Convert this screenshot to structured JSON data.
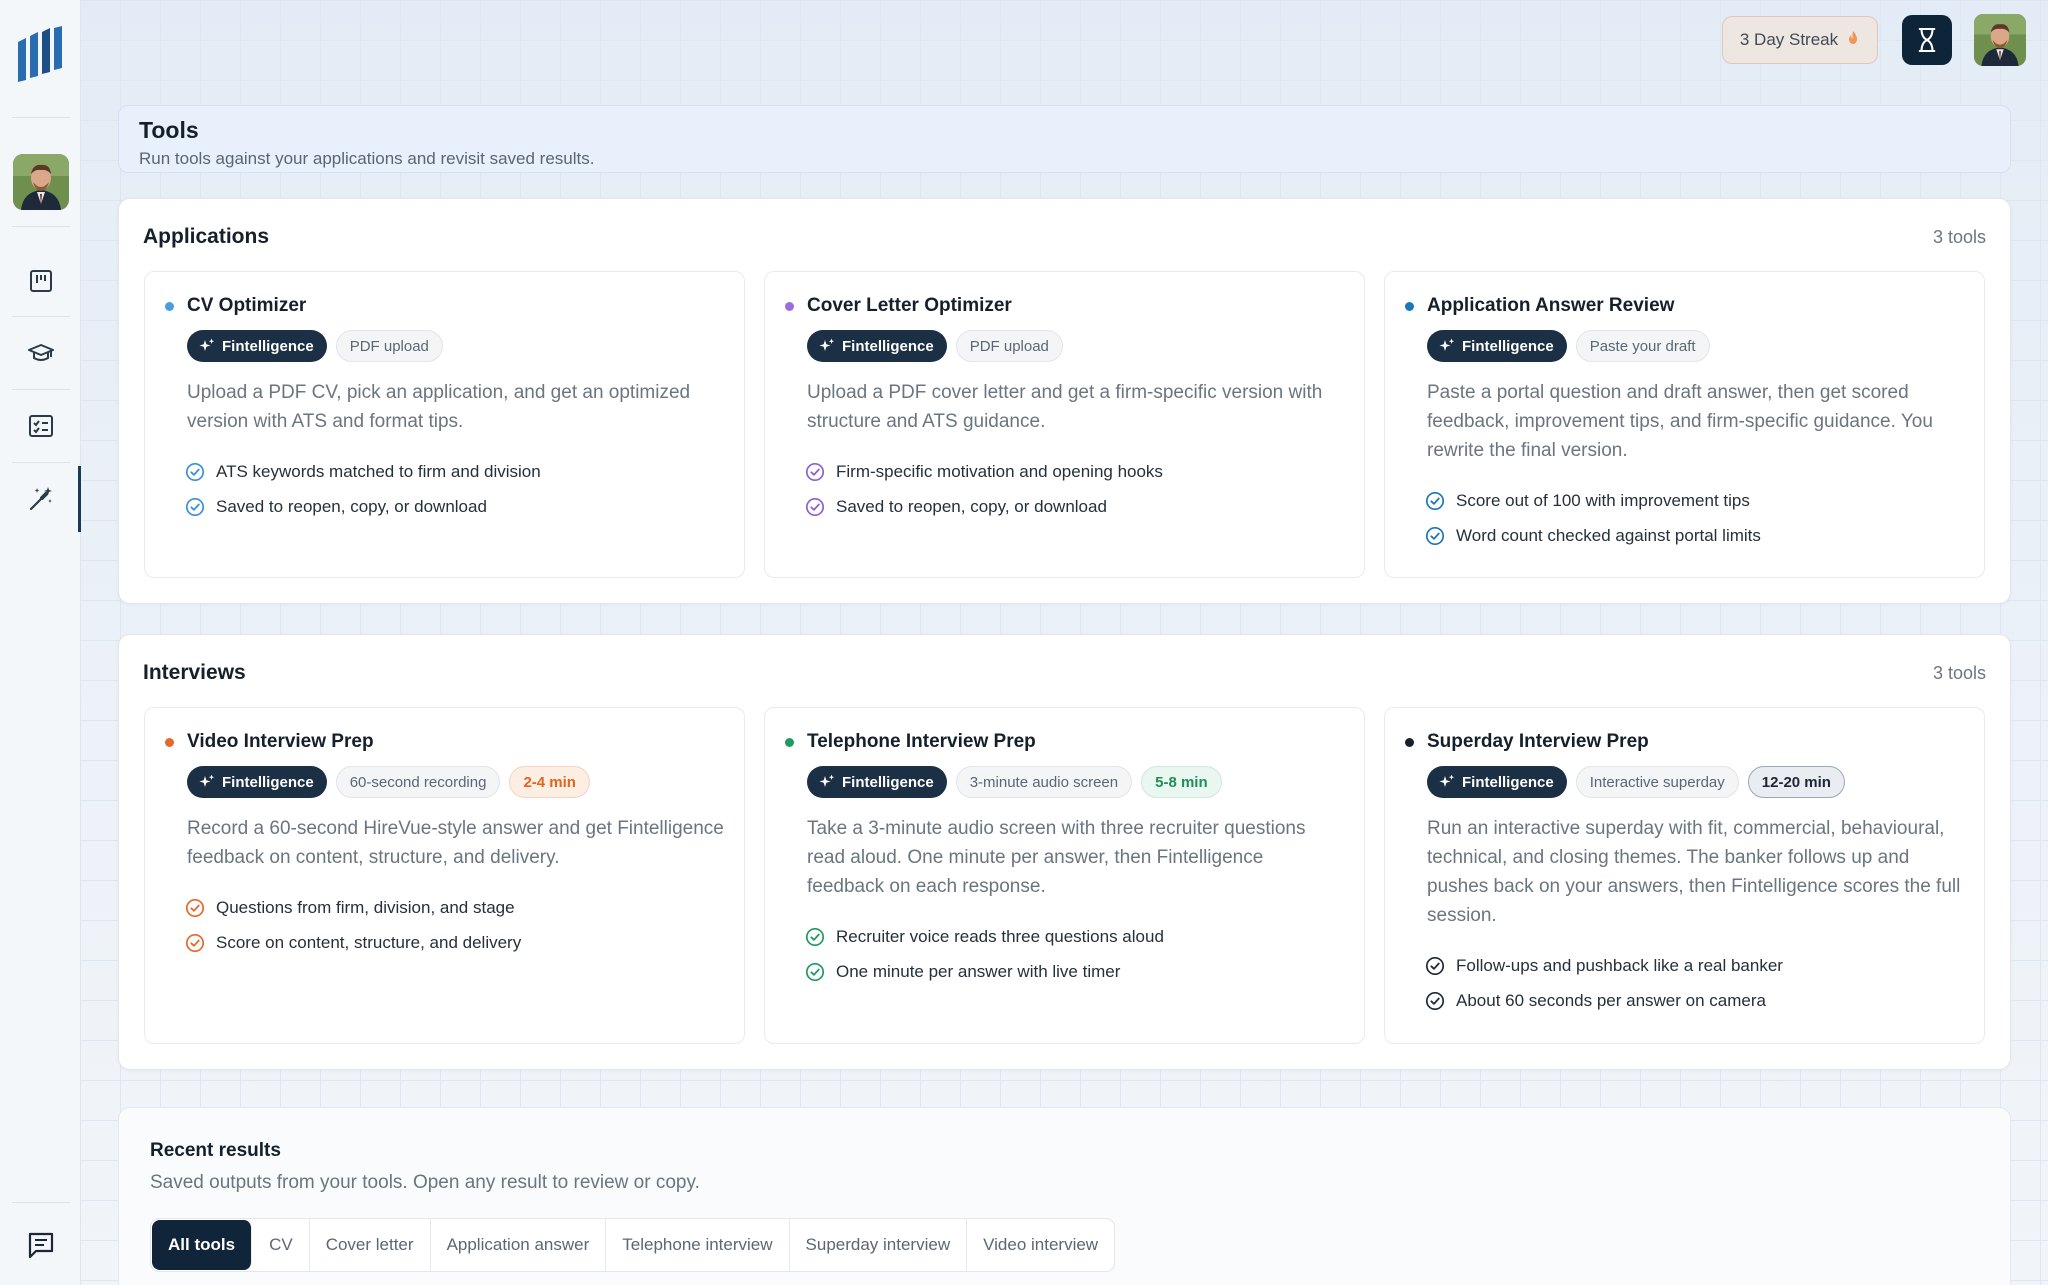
{
  "topbar": {
    "streak_label": "3 Day Streak",
    "streak_icon": "flame-icon"
  },
  "sidebar": {
    "items": [
      {
        "name": "board-icon"
      },
      {
        "name": "graduation-cap-icon"
      },
      {
        "name": "checklist-icon"
      },
      {
        "name": "magic-wand-icon",
        "active": true
      }
    ],
    "footer_icon": "chat-icon"
  },
  "header": {
    "title": "Tools",
    "subtitle": "Run tools against your applications and revisit saved results."
  },
  "applications": {
    "title": "Applications",
    "count": "3 tools",
    "cards": [
      {
        "title": "CV Optimizer",
        "dot_color": "#4a9be0",
        "ai_badge": "Fintelligence",
        "badges": [
          "PDF upload"
        ],
        "desc": "Upload a PDF CV, pick an application, and get an optimized version with ATS and format tips.",
        "check_color": "#3a8fd8",
        "features": [
          "ATS keywords matched to firm and division",
          "Saved to reopen, copy, or download"
        ]
      },
      {
        "title": "Cover Letter Optimizer",
        "dot_color": "#9b6ddc",
        "ai_badge": "Fintelligence",
        "badges": [
          "PDF upload"
        ],
        "desc": "Upload a PDF cover letter and get a firm-specific version with structure and ATS guidance.",
        "check_color": "#8a63c9",
        "features": [
          "Firm-specific motivation and opening hooks",
          "Saved to reopen, copy, or download"
        ]
      },
      {
        "title": "Application Answer Review",
        "dot_color": "#1a78b8",
        "ai_badge": "Fintelligence",
        "badges": [
          "Paste your draft"
        ],
        "desc": "Paste a portal question and draft answer, then get scored feedback, improvement tips, and firm-specific guidance. You rewrite the final version.",
        "check_color": "#1a78b8",
        "features": [
          "Score out of 100 with improvement tips",
          "Word count checked against portal limits"
        ]
      }
    ]
  },
  "interviews": {
    "title": "Interviews",
    "count": "3 tools",
    "cards": [
      {
        "title": "Video Interview Prep",
        "dot_color": "#e8672a",
        "ai_badge": "Fintelligence",
        "badges": [
          "60-second recording"
        ],
        "time_badge": "2-4 min",
        "desc": "Record a 60-second HireVue-style answer and get Fintelligence feedback on content, structure, and delivery.",
        "check_color": "#e8672a",
        "features": [
          "Questions from firm, division, and stage",
          "Score on content, structure, and delivery"
        ]
      },
      {
        "title": "Telephone Interview Prep",
        "dot_color": "#1f9a60",
        "ai_badge": "Fintelligence",
        "badges": [
          "3-minute audio screen"
        ],
        "time_badge": "5-8 min",
        "desc": "Take a 3-minute audio screen with three recruiter questions read aloud. One minute per answer, then Fintelligence feedback on each response.",
        "check_color": "#1f9a60",
        "features": [
          "Recruiter voice reads three questions aloud",
          "One minute per answer with live timer"
        ]
      },
      {
        "title": "Superday Interview Prep",
        "dot_color": "#17212c",
        "ai_badge": "Fintelligence",
        "badges": [
          "Interactive superday"
        ],
        "time_badge": "12-20 min",
        "desc": "Run an interactive superday with fit, commercial, behavioural, technical, and closing themes. The banker follows up and pushes back on your answers, then Fintelligence scores the full session.",
        "check_color": "#1f2a37",
        "features": [
          "Follow-ups and pushback like a real banker",
          "About 60 seconds per answer on camera"
        ]
      }
    ]
  },
  "recent": {
    "title": "Recent results",
    "subtitle": "Saved outputs from your tools. Open any result to review or copy.",
    "filters": [
      "All tools",
      "CV",
      "Cover letter",
      "Application answer",
      "Telephone interview",
      "Superday interview",
      "Video interview"
    ]
  }
}
